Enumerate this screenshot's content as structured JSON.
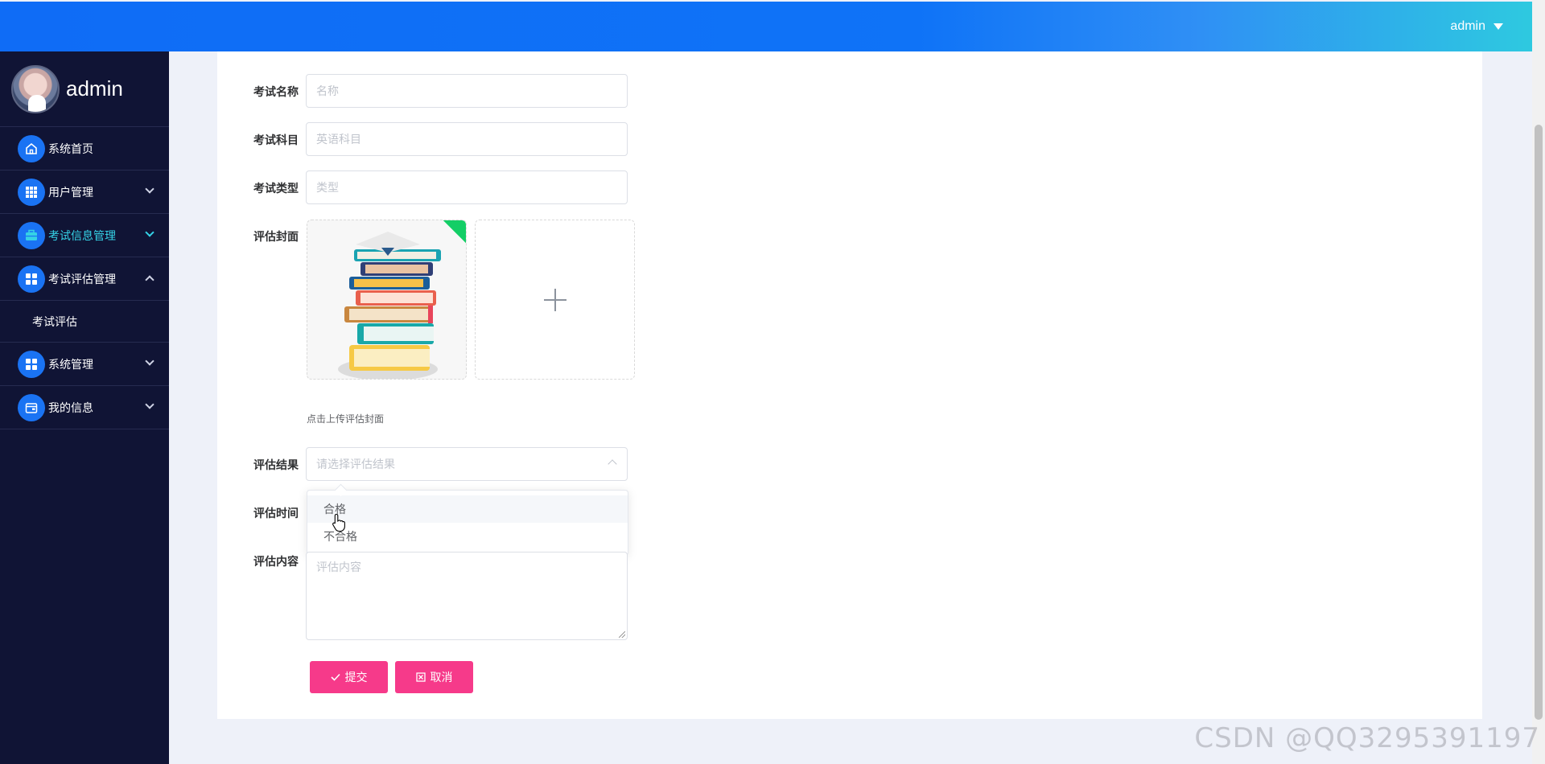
{
  "header": {
    "username": "admin"
  },
  "sidebar": {
    "profile_name": "admin",
    "items": [
      {
        "label": "系统首页",
        "icon": "home-icon"
      },
      {
        "label": "用户管理",
        "icon": "grid-icon"
      },
      {
        "label": "考试信息管理",
        "icon": "briefcase-icon"
      },
      {
        "label": "考试评估管理",
        "icon": "apps-icon"
      },
      {
        "label": "系统管理",
        "icon": "apps-icon"
      },
      {
        "label": "我的信息",
        "icon": "wallet-icon"
      }
    ],
    "submenu": {
      "label": "考试评估"
    }
  },
  "form": {
    "exam_name": {
      "label": "考试名称",
      "placeholder": "名称"
    },
    "exam_subject": {
      "label": "考试科目",
      "placeholder": "英语科目"
    },
    "exam_type": {
      "label": "考试类型",
      "placeholder": "类型"
    },
    "cover": {
      "label": "评估封面",
      "hint": "点击上传评估封面"
    },
    "result": {
      "label": "评估结果",
      "placeholder": "请选择评估结果",
      "options": [
        "合格",
        "不合格"
      ]
    },
    "time": {
      "label": "评估时间"
    },
    "content": {
      "label": "评估内容",
      "placeholder": "评估内容"
    },
    "submit_label": "提交",
    "cancel_label": "取消"
  },
  "watermark": "CSDN @QQ3295391197",
  "colors": {
    "topbar": "#0f6cf6",
    "sidebar": "#101435",
    "accent": "#35d2e6",
    "button": "#f63a8a"
  }
}
